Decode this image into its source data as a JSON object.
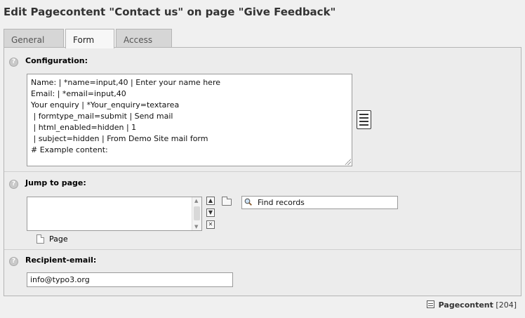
{
  "page_title": "Edit Pagecontent \"Contact us\" on page \"Give Feedback\"",
  "tabs": [
    {
      "label": "General",
      "active": false
    },
    {
      "label": "Form",
      "active": true
    },
    {
      "label": "Access",
      "active": false
    }
  ],
  "configuration": {
    "label": "Configuration:",
    "lines": [
      "Name: | *name=input,40 | Enter your name here",
      "Email: | *email=input,40",
      "Your enquiry | *Your_enquiry=textarea",
      " | formtype_mail=submit | Send mail",
      " | html_enabled=hidden | 1",
      " | subject=hidden | From Demo Site mail form",
      "# Example content:"
    ],
    "wizard_icon": "form-wizard-icon"
  },
  "jump_to_page": {
    "label": "Jump to page:",
    "find_placeholder": "Find records",
    "allowed_type": "Page"
  },
  "recipient_email": {
    "label": "Recipient-email:",
    "value": "info@typo3.org"
  },
  "footer": {
    "title": "Pagecontent",
    "uid": "[204]"
  }
}
